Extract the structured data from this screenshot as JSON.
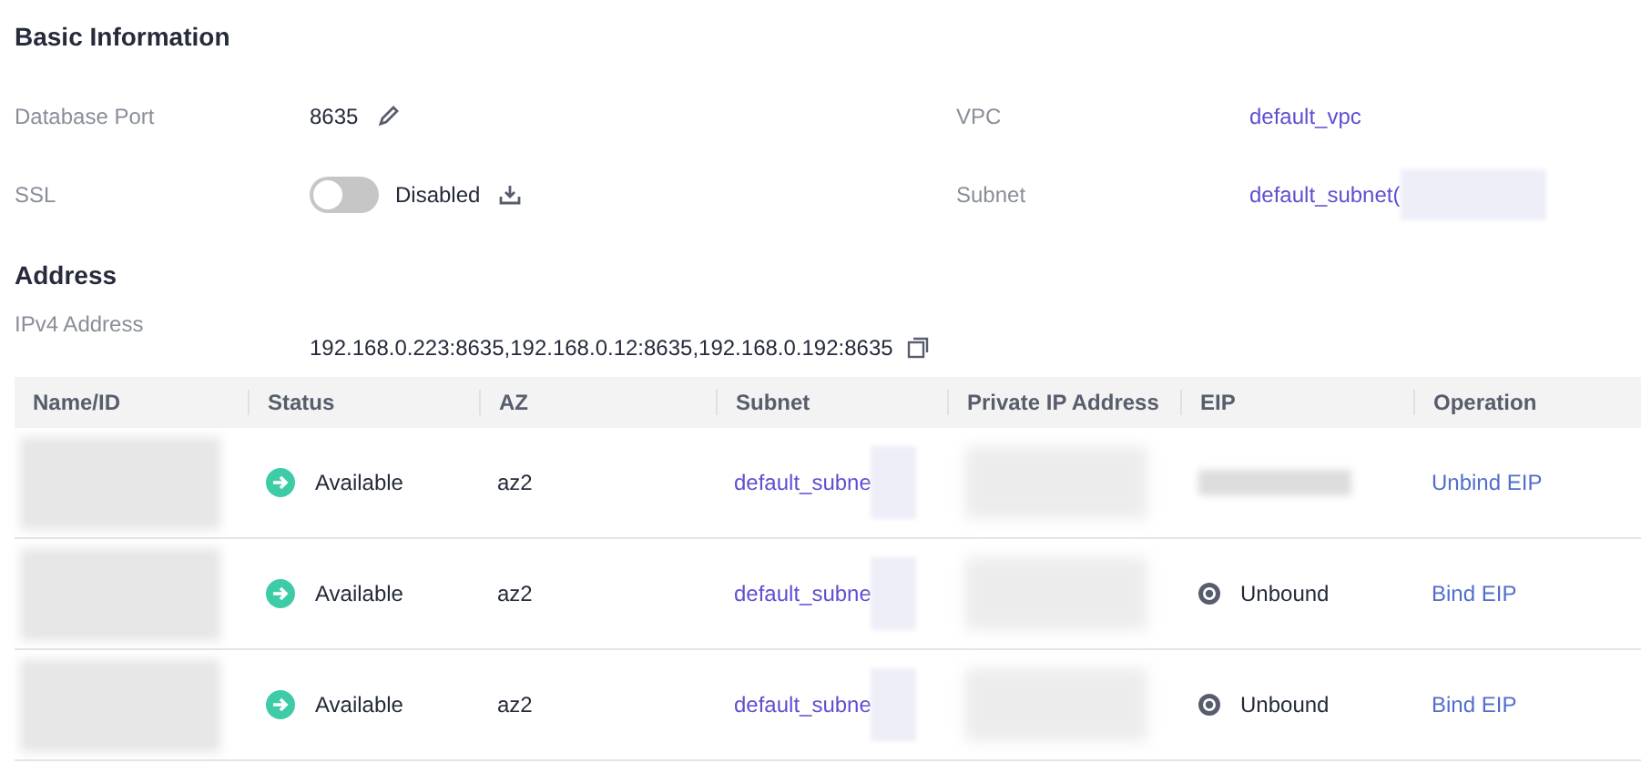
{
  "basic_information": {
    "title": "Basic Information",
    "database_port": {
      "label": "Database Port",
      "value": "8635"
    },
    "vpc": {
      "label": "VPC",
      "value": "default_vpc"
    },
    "ssl": {
      "label": "SSL",
      "on": false,
      "status": "Disabled"
    },
    "subnet": {
      "label": "Subnet",
      "value": "default_subnet("
    }
  },
  "address": {
    "title": "Address",
    "ipv4": {
      "label": "IPv4 Address",
      "value": "192.168.0.223:8635,192.168.0.12:8635,192.168.0.192:8635"
    }
  },
  "table": {
    "columns": [
      "Name/ID",
      "Status",
      "AZ",
      "Subnet",
      "Private IP Address",
      "EIP",
      "Operation"
    ],
    "rows": [
      {
        "status": "Available",
        "az": "az2",
        "subnet": "default_subne",
        "eip": {
          "kind": "redacted"
        },
        "operation": "Unbind EIP"
      },
      {
        "status": "Available",
        "az": "az2",
        "subnet": "default_subne",
        "eip": {
          "kind": "unbound",
          "text": "Unbound"
        },
        "operation": "Bind EIP"
      },
      {
        "status": "Available",
        "az": "az2",
        "subnet": "default_subne",
        "eip": {
          "kind": "unbound",
          "text": "Unbound"
        },
        "operation": "Bind EIP"
      }
    ]
  }
}
